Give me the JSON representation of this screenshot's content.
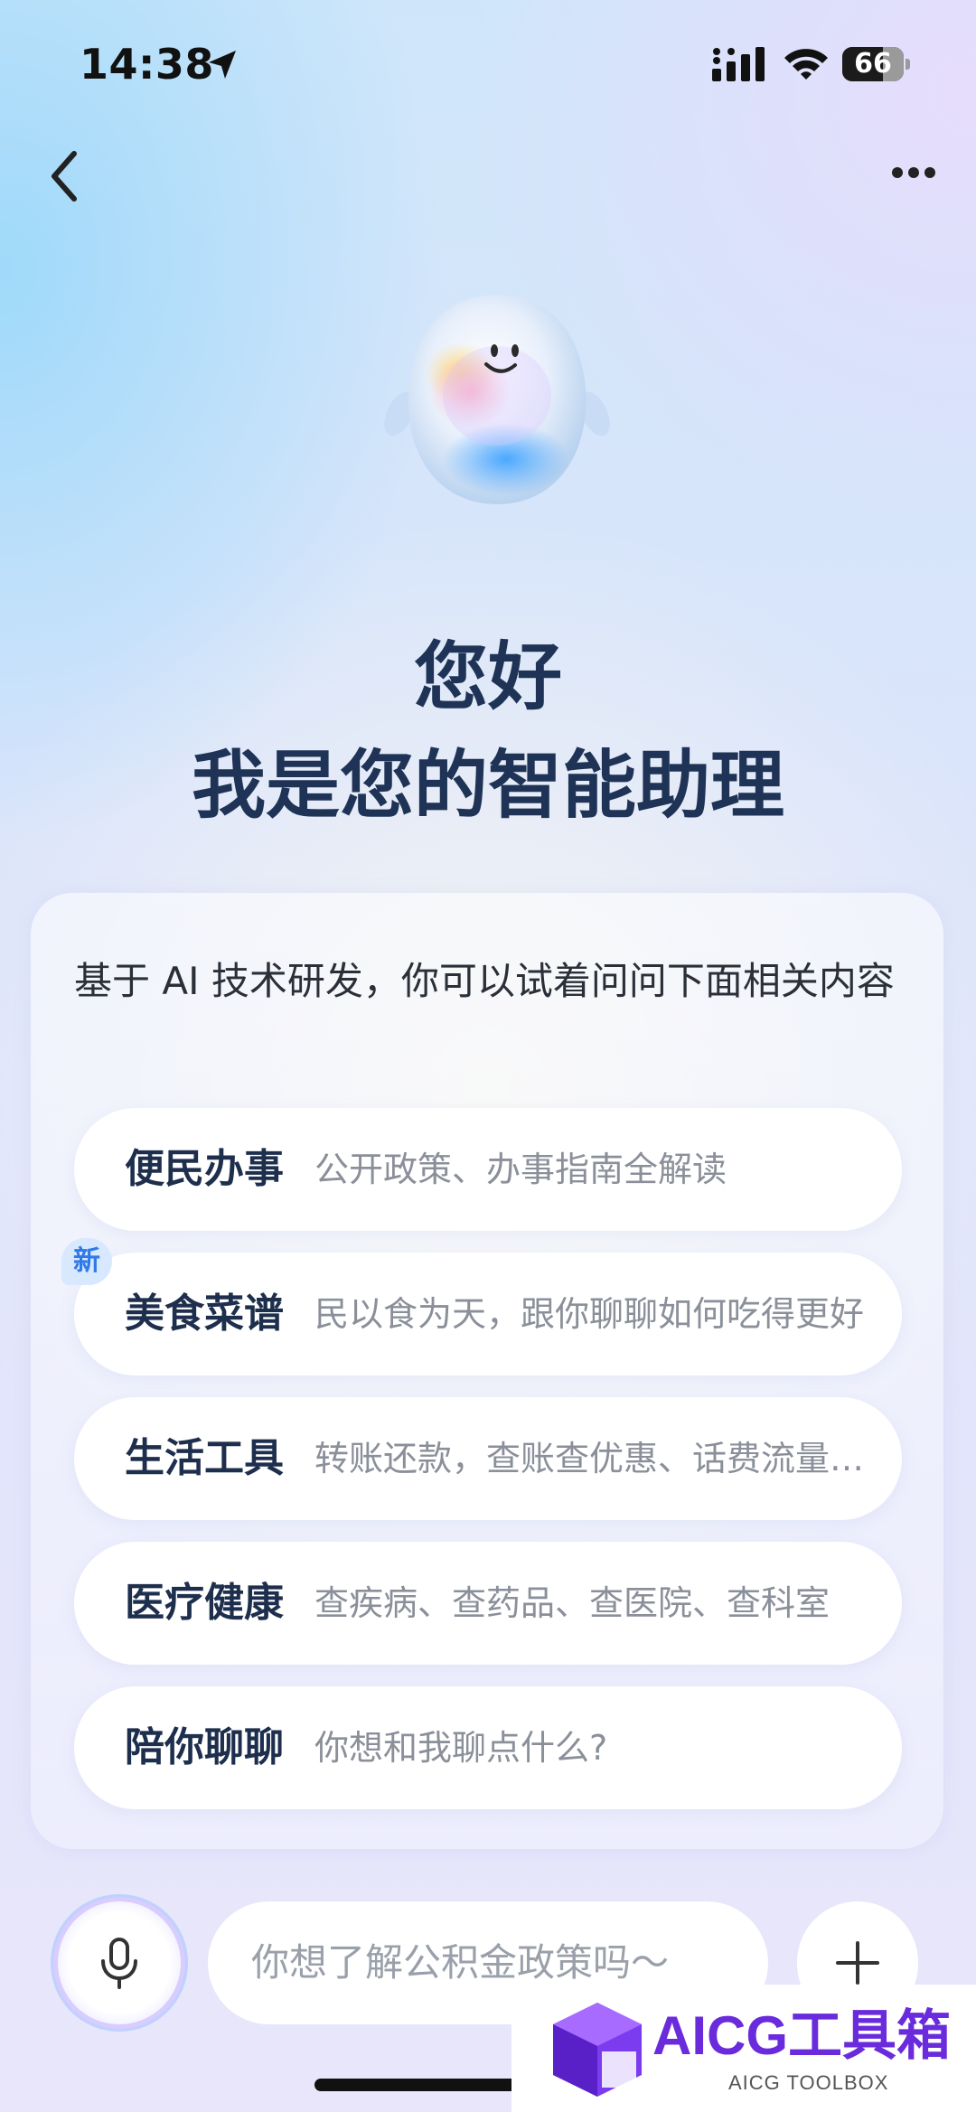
{
  "status_bar": {
    "time": "14:38",
    "battery_percent": "66",
    "battery_level": 0.66
  },
  "greeting": {
    "line1": "您好",
    "line2": "我是您的智能助理"
  },
  "intro_text": "基于 AI 技术研发，你可以试着问问下面相关内容",
  "suggestions": [
    {
      "title": "便民办事",
      "desc": "公开政策、办事指南全解读",
      "badge": ""
    },
    {
      "title": "美食菜谱",
      "desc": "民以食为天，跟你聊聊如何吃得更好",
      "badge": "新"
    },
    {
      "title": "生活工具",
      "desc": "转账还款，查账查优惠、话费流量…",
      "badge": ""
    },
    {
      "title": "医疗健康",
      "desc": "查疾病、查药品、查医院、查科室",
      "badge": ""
    },
    {
      "title": "陪你聊聊",
      "desc": "你想和我聊点什么?",
      "badge": ""
    }
  ],
  "input": {
    "placeholder": "你想了解公积金政策吗～"
  },
  "watermark": {
    "title": "AICG工具箱",
    "subtitle": "AICG TOOLBOX"
  },
  "colors": {
    "title_text": "#1e3356",
    "accent_blue": "#2f79e8",
    "watermark_purple": "#6a2bdc"
  },
  "icons": [
    "location-arrow-icon",
    "cellular-signal-icon",
    "wifi-icon",
    "battery-icon",
    "back-chevron-icon",
    "more-dots-icon",
    "assistant-mascot",
    "microphone-icon",
    "plus-icon",
    "aicg-logo"
  ]
}
